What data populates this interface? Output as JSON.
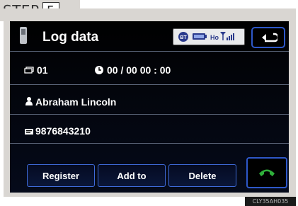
{
  "step": {
    "label": "STEP",
    "number": "5"
  },
  "screen": {
    "title": "Log data",
    "status": {
      "bt": "BT",
      "ho": "Ho"
    },
    "entry_number": "01",
    "datetime": "00 / 00  00 : 00",
    "contact_name": "Abraham Lincoln",
    "phone_number": "9876843210"
  },
  "buttons": {
    "register": "Register",
    "add_to": "Add to",
    "delete": "Delete"
  },
  "image_code": "CLY35AH035",
  "colors": {
    "screen_bg": "#000000",
    "accent_blue": "#2e58c9",
    "call_green": "#2fae3a"
  }
}
